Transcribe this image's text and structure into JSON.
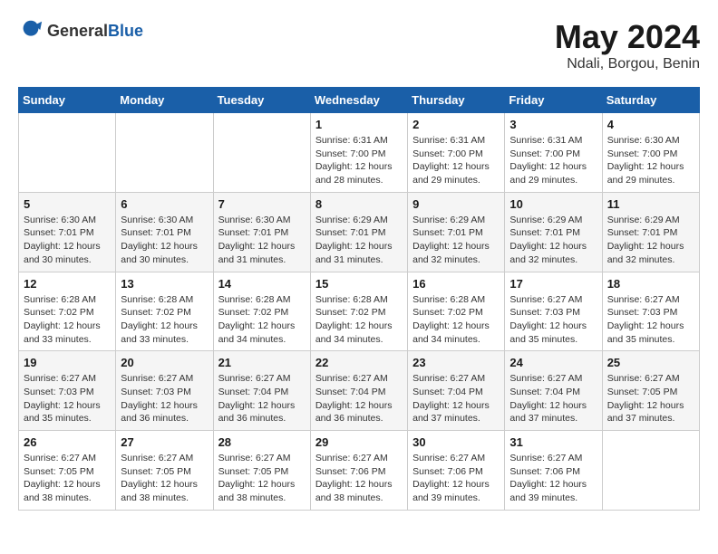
{
  "logo": {
    "general": "General",
    "blue": "Blue"
  },
  "header": {
    "month": "May 2024",
    "location": "Ndali, Borgou, Benin"
  },
  "weekdays": [
    "Sunday",
    "Monday",
    "Tuesday",
    "Wednesday",
    "Thursday",
    "Friday",
    "Saturday"
  ],
  "weeks": [
    [
      {
        "day": "",
        "info": ""
      },
      {
        "day": "",
        "info": ""
      },
      {
        "day": "",
        "info": ""
      },
      {
        "day": "1",
        "info": "Sunrise: 6:31 AM\nSunset: 7:00 PM\nDaylight: 12 hours\nand 28 minutes."
      },
      {
        "day": "2",
        "info": "Sunrise: 6:31 AM\nSunset: 7:00 PM\nDaylight: 12 hours\nand 29 minutes."
      },
      {
        "day": "3",
        "info": "Sunrise: 6:31 AM\nSunset: 7:00 PM\nDaylight: 12 hours\nand 29 minutes."
      },
      {
        "day": "4",
        "info": "Sunrise: 6:30 AM\nSunset: 7:00 PM\nDaylight: 12 hours\nand 29 minutes."
      }
    ],
    [
      {
        "day": "5",
        "info": "Sunrise: 6:30 AM\nSunset: 7:01 PM\nDaylight: 12 hours\nand 30 minutes."
      },
      {
        "day": "6",
        "info": "Sunrise: 6:30 AM\nSunset: 7:01 PM\nDaylight: 12 hours\nand 30 minutes."
      },
      {
        "day": "7",
        "info": "Sunrise: 6:30 AM\nSunset: 7:01 PM\nDaylight: 12 hours\nand 31 minutes."
      },
      {
        "day": "8",
        "info": "Sunrise: 6:29 AM\nSunset: 7:01 PM\nDaylight: 12 hours\nand 31 minutes."
      },
      {
        "day": "9",
        "info": "Sunrise: 6:29 AM\nSunset: 7:01 PM\nDaylight: 12 hours\nand 32 minutes."
      },
      {
        "day": "10",
        "info": "Sunrise: 6:29 AM\nSunset: 7:01 PM\nDaylight: 12 hours\nand 32 minutes."
      },
      {
        "day": "11",
        "info": "Sunrise: 6:29 AM\nSunset: 7:01 PM\nDaylight: 12 hours\nand 32 minutes."
      }
    ],
    [
      {
        "day": "12",
        "info": "Sunrise: 6:28 AM\nSunset: 7:02 PM\nDaylight: 12 hours\nand 33 minutes."
      },
      {
        "day": "13",
        "info": "Sunrise: 6:28 AM\nSunset: 7:02 PM\nDaylight: 12 hours\nand 33 minutes."
      },
      {
        "day": "14",
        "info": "Sunrise: 6:28 AM\nSunset: 7:02 PM\nDaylight: 12 hours\nand 34 minutes."
      },
      {
        "day": "15",
        "info": "Sunrise: 6:28 AM\nSunset: 7:02 PM\nDaylight: 12 hours\nand 34 minutes."
      },
      {
        "day": "16",
        "info": "Sunrise: 6:28 AM\nSunset: 7:02 PM\nDaylight: 12 hours\nand 34 minutes."
      },
      {
        "day": "17",
        "info": "Sunrise: 6:27 AM\nSunset: 7:03 PM\nDaylight: 12 hours\nand 35 minutes."
      },
      {
        "day": "18",
        "info": "Sunrise: 6:27 AM\nSunset: 7:03 PM\nDaylight: 12 hours\nand 35 minutes."
      }
    ],
    [
      {
        "day": "19",
        "info": "Sunrise: 6:27 AM\nSunset: 7:03 PM\nDaylight: 12 hours\nand 35 minutes."
      },
      {
        "day": "20",
        "info": "Sunrise: 6:27 AM\nSunset: 7:03 PM\nDaylight: 12 hours\nand 36 minutes."
      },
      {
        "day": "21",
        "info": "Sunrise: 6:27 AM\nSunset: 7:04 PM\nDaylight: 12 hours\nand 36 minutes."
      },
      {
        "day": "22",
        "info": "Sunrise: 6:27 AM\nSunset: 7:04 PM\nDaylight: 12 hours\nand 36 minutes."
      },
      {
        "day": "23",
        "info": "Sunrise: 6:27 AM\nSunset: 7:04 PM\nDaylight: 12 hours\nand 37 minutes."
      },
      {
        "day": "24",
        "info": "Sunrise: 6:27 AM\nSunset: 7:04 PM\nDaylight: 12 hours\nand 37 minutes."
      },
      {
        "day": "25",
        "info": "Sunrise: 6:27 AM\nSunset: 7:05 PM\nDaylight: 12 hours\nand 37 minutes."
      }
    ],
    [
      {
        "day": "26",
        "info": "Sunrise: 6:27 AM\nSunset: 7:05 PM\nDaylight: 12 hours\nand 38 minutes."
      },
      {
        "day": "27",
        "info": "Sunrise: 6:27 AM\nSunset: 7:05 PM\nDaylight: 12 hours\nand 38 minutes."
      },
      {
        "day": "28",
        "info": "Sunrise: 6:27 AM\nSunset: 7:05 PM\nDaylight: 12 hours\nand 38 minutes."
      },
      {
        "day": "29",
        "info": "Sunrise: 6:27 AM\nSunset: 7:06 PM\nDaylight: 12 hours\nand 38 minutes."
      },
      {
        "day": "30",
        "info": "Sunrise: 6:27 AM\nSunset: 7:06 PM\nDaylight: 12 hours\nand 39 minutes."
      },
      {
        "day": "31",
        "info": "Sunrise: 6:27 AM\nSunset: 7:06 PM\nDaylight: 12 hours\nand 39 minutes."
      },
      {
        "day": "",
        "info": ""
      }
    ]
  ]
}
